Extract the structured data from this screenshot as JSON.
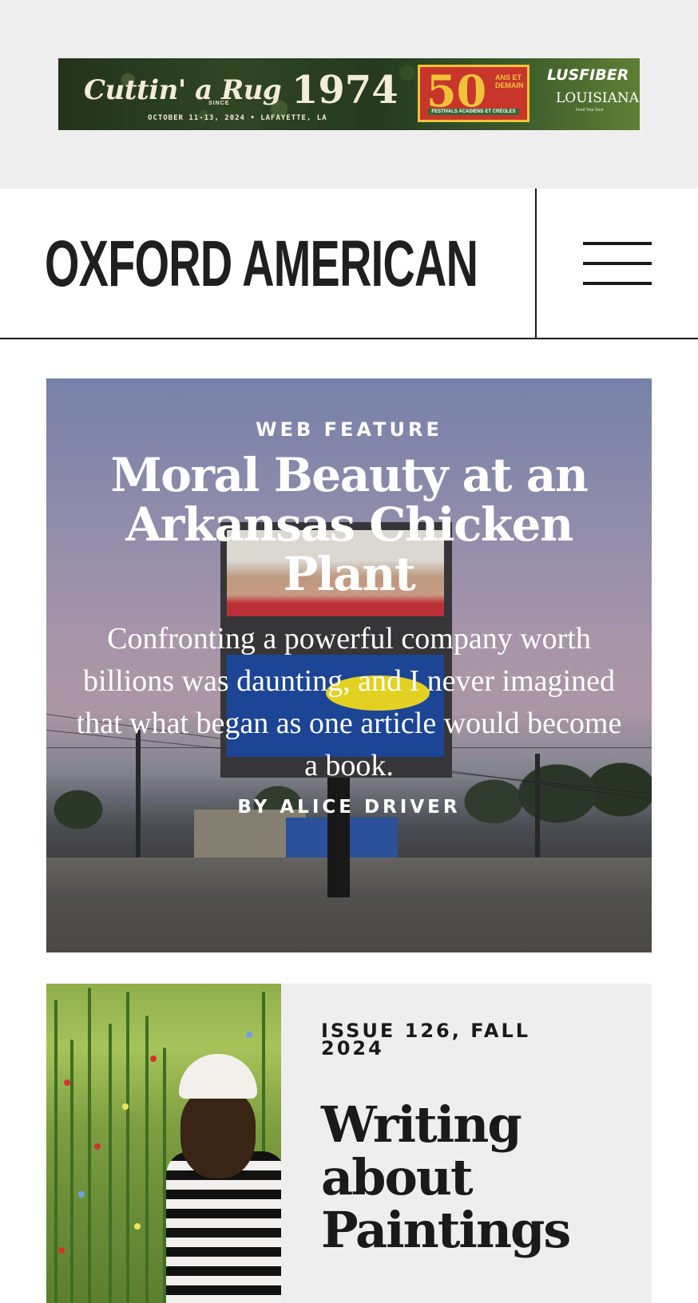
{
  "ad": {
    "script_text": "Cuttin' a Rug",
    "since": "SINCE",
    "year": "1974",
    "dates": "OCTOBER 11-13, 2024 • LAFAYETTE, LA",
    "badge_number": "50",
    "badge_side": "ANS ET DEMAIN",
    "badge_foot": "FESTIVALS ACADIENS ET CRÉOLES",
    "sponsor_1": "LUSFIBER",
    "sponsor_2": "LOUISIANA",
    "sponsor_2_tag": "Feed Your Soul"
  },
  "header": {
    "logo": "OXFORD AMERICAN"
  },
  "feature": {
    "kicker": "WEB FEATURE",
    "title": "Moral Beauty at an Arkansas Chicken Plant",
    "dek": "Confronting a powerful company worth billions was daunting, and I never imagined that what began as one article would become a book.",
    "byline": "BY ALICE DRIVER"
  },
  "issue_card": {
    "label": "ISSUE 126, FALL 2024",
    "title": "Writing about Paintings"
  }
}
